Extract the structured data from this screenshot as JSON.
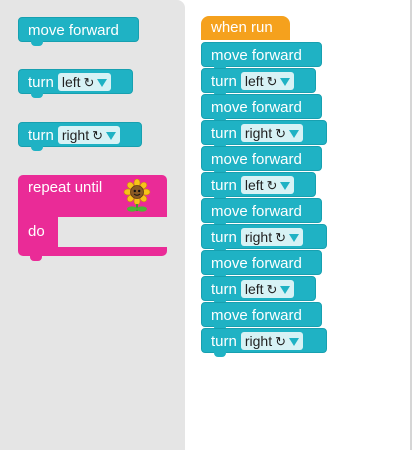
{
  "toolbox": {
    "move_block": {
      "label": "move forward"
    },
    "turn_left_block": {
      "label": "turn",
      "dropdown": "left",
      "rotate_glyph": "↻"
    },
    "turn_right_block": {
      "label": "turn",
      "dropdown": "right",
      "rotate_glyph": "↻"
    },
    "repeat_block": {
      "label": "repeat until",
      "do_label": "do",
      "target_icon": "sunflower-icon"
    }
  },
  "workspace": {
    "hat": {
      "label": "when run"
    },
    "program": [
      {
        "label": "move forward"
      },
      {
        "label": "turn",
        "dropdown": "left"
      },
      {
        "label": "move forward"
      },
      {
        "label": "turn",
        "dropdown": "right"
      },
      {
        "label": "move forward"
      },
      {
        "label": "turn",
        "dropdown": "left"
      },
      {
        "label": "move forward"
      },
      {
        "label": "turn",
        "dropdown": "right"
      },
      {
        "label": "move forward"
      },
      {
        "label": "turn",
        "dropdown": "left"
      },
      {
        "label": "move forward"
      },
      {
        "label": "turn",
        "dropdown": "right"
      }
    ],
    "rotate_glyph": "↻"
  },
  "colors": {
    "motion": "#1fb2c4",
    "event": "#f5a11d",
    "loop": "#ea2b97",
    "toolbox_bg": "#e5e5e5"
  }
}
